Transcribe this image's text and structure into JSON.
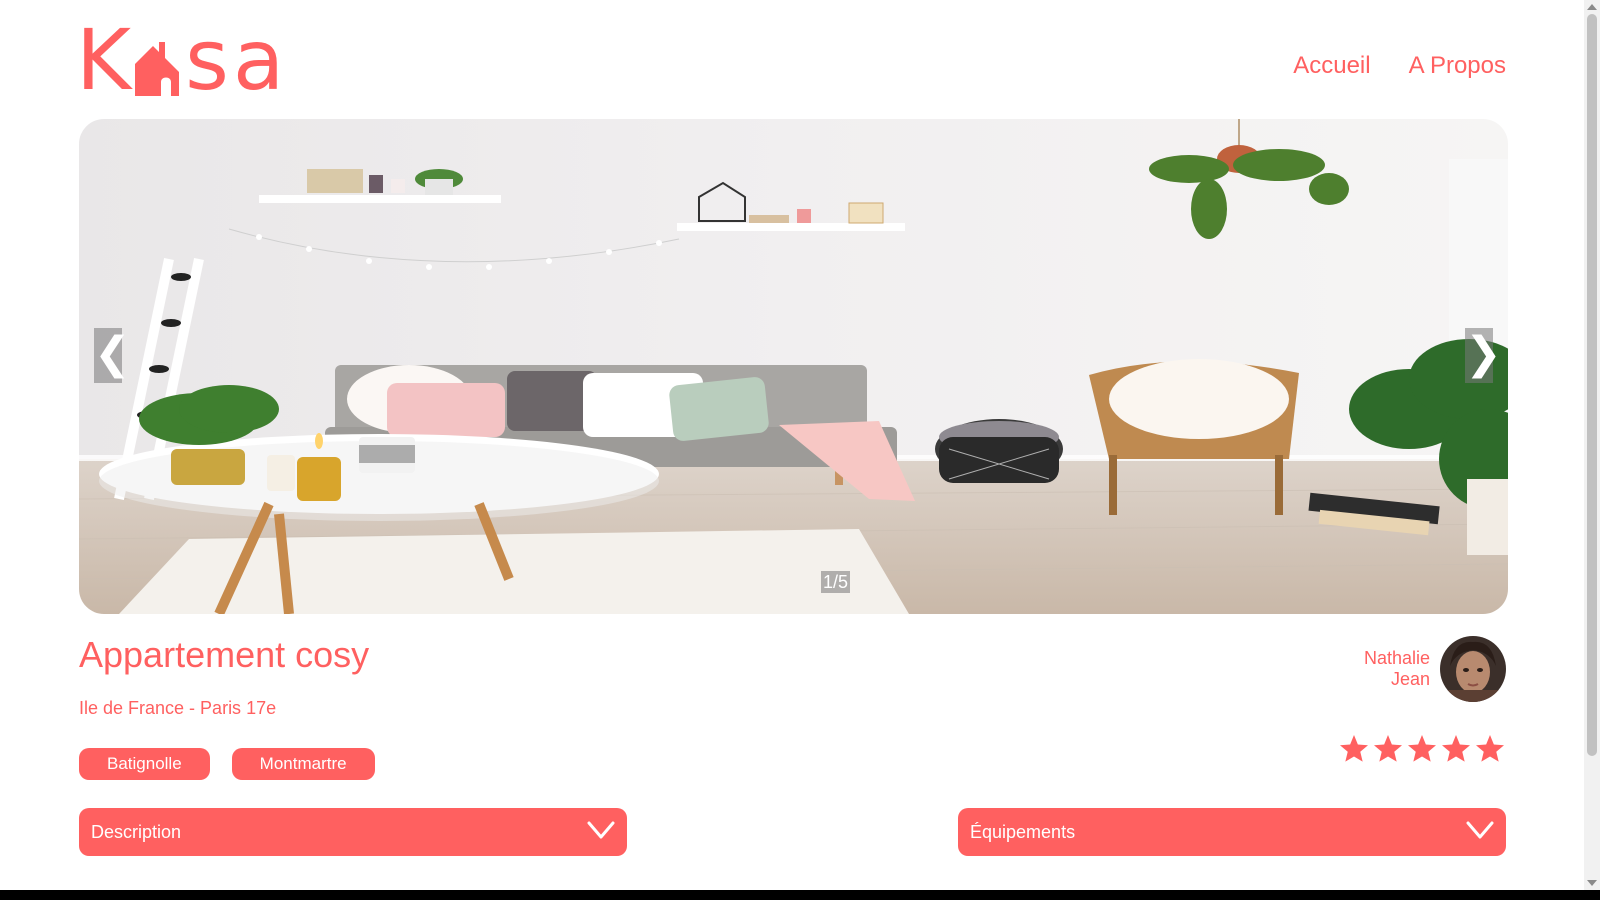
{
  "header": {
    "logo": {
      "letter_k": "K",
      "letters_sa": "sa",
      "icon": "house-icon"
    },
    "nav": [
      {
        "label": "Accueil"
      },
      {
        "label": "A Propos"
      }
    ]
  },
  "carousel": {
    "prev_icon": "❮",
    "next_icon": "❯",
    "counter": "1/5",
    "current": 1,
    "total": 5
  },
  "listing": {
    "title": "Appartement cosy",
    "location": "Ile de France - Paris 17e",
    "tags": [
      "Batignolle",
      "Montmartre"
    ],
    "host": {
      "first_name": "Nathalie",
      "last_name": "Jean"
    },
    "rating": {
      "value": 5,
      "max": 5
    }
  },
  "collapses": {
    "description": {
      "label": "Description",
      "icon": "chevron-down-icon"
    },
    "equipments": {
      "label": "Équipements",
      "icon": "chevron-down-icon"
    }
  },
  "colors": {
    "accent": "#FF6060",
    "white": "#FFFFFF"
  }
}
